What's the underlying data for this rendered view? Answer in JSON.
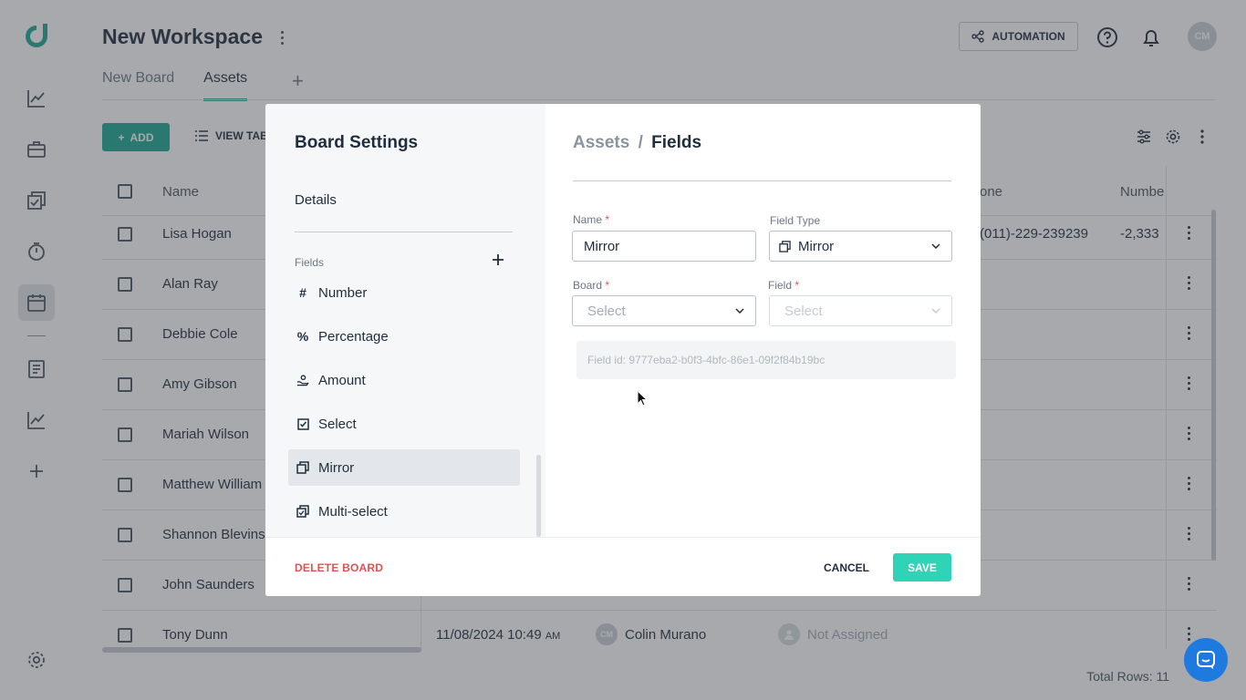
{
  "workspace": {
    "title": "New Workspace"
  },
  "tabs": [
    {
      "label": "New Board",
      "active": false
    },
    {
      "label": "Assets",
      "active": true
    }
  ],
  "header": {
    "automation_label": "AUTOMATION",
    "avatar_initials": "CM"
  },
  "toolbar": {
    "add_label": "ADD",
    "view_label": "VIEW TAB"
  },
  "table": {
    "columns": {
      "name": "Name",
      "phone": "one",
      "number": "Numbe"
    },
    "rows": [
      {
        "name": "Lisa Hogan",
        "phone": "(011)-229-239239",
        "number": "-2,333"
      },
      {
        "name": "Alan Ray"
      },
      {
        "name": "Debbie Cole"
      },
      {
        "name": "Amy Gibson"
      },
      {
        "name": "Mariah Wilson"
      },
      {
        "name": "Matthew William"
      },
      {
        "name": "Shannon Blevins"
      },
      {
        "name": "John Saunders"
      },
      {
        "name": "Tony Dunn",
        "date": "11/08/2024 10:49",
        "date_suffix": "AM",
        "owner": "Colin Murano",
        "owner_initials": "CM",
        "assignee": "Not Assigned"
      }
    ],
    "total_rows": "Total Rows: 11"
  },
  "modal": {
    "title": "Board Settings",
    "details_label": "Details",
    "fields_label": "Fields",
    "fields": [
      {
        "label": "Number",
        "icon": "hash-icon",
        "active": false
      },
      {
        "label": "Percentage",
        "icon": "percent-icon",
        "active": false
      },
      {
        "label": "Amount",
        "icon": "amount-icon",
        "active": false
      },
      {
        "label": "Select",
        "icon": "checkbox-icon",
        "active": false
      },
      {
        "label": "Mirror",
        "icon": "mirror-icon",
        "active": true
      },
      {
        "label": "Multi-select",
        "icon": "multi-select-icon",
        "active": false
      }
    ],
    "breadcrumb": {
      "parent": "Assets",
      "separator": "/",
      "current": "Fields"
    },
    "form": {
      "name_label": "Name",
      "name_value": "Mirror",
      "field_type_label": "Field Type",
      "field_type_value": "Mirror",
      "board_label": "Board",
      "board_placeholder": "Select",
      "field_label": "Field",
      "field_placeholder": "Select",
      "required_mark": "*",
      "field_id": "Field id: 9777eba2-b0f3-4bfc-86e1-09f2f84b19bc"
    },
    "footer": {
      "delete_label": "DELETE BOARD",
      "cancel_label": "CANCEL",
      "save_label": "SAVE"
    }
  },
  "colors": {
    "accent": "#1ba892",
    "save": "#2fd3b5",
    "danger": "#e05252",
    "chat": "#1f7ae0"
  }
}
